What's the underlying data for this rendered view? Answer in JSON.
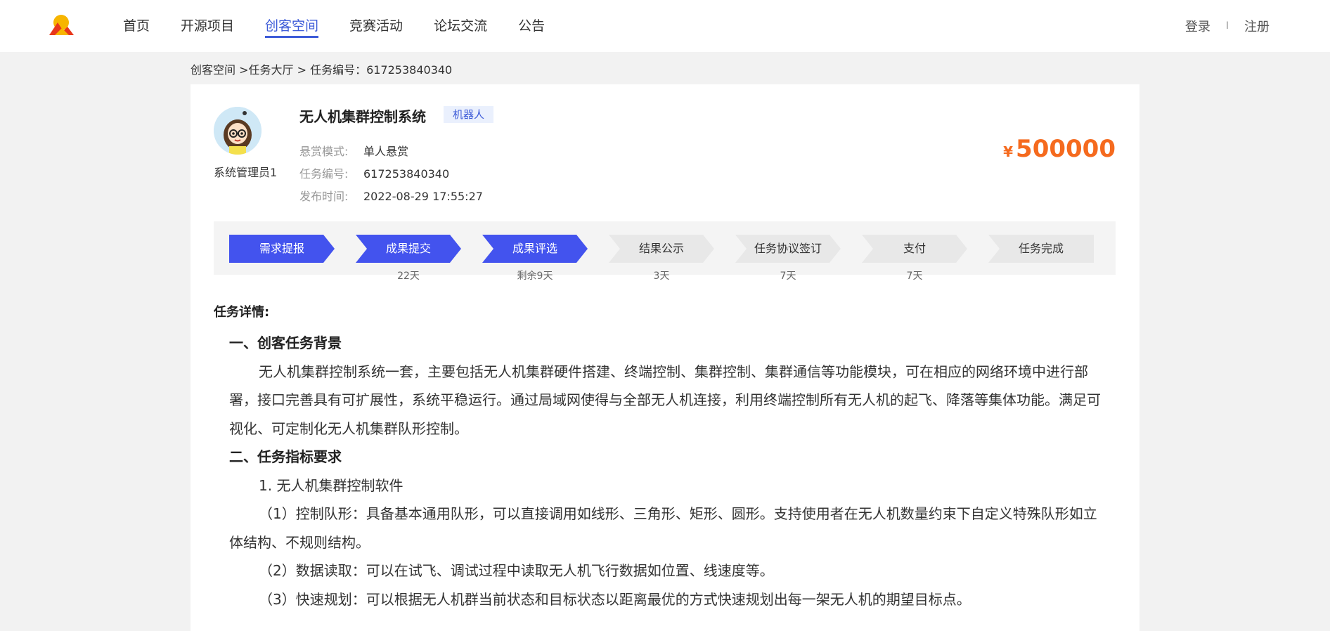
{
  "nav": {
    "items": [
      "首页",
      "开源项目",
      "创客空间",
      "竞赛活动",
      "论坛交流",
      "公告"
    ],
    "active_index": 2
  },
  "auth": {
    "login": "登录",
    "separator": "I",
    "register": "注册"
  },
  "breadcrumb": "创客空间 >任务大厅 > 任务编号：617253840340",
  "task": {
    "author": "系统管理员1",
    "title": "无人机集群控制系统",
    "tag": "机器人",
    "meta": [
      {
        "label": "悬赏模式:",
        "value": "单人悬赏"
      },
      {
        "label": "任务编号:",
        "value": "617253840340"
      },
      {
        "label": "发布时间:",
        "value": "2022-08-29 17:55:27"
      }
    ],
    "price_currency": "¥",
    "price": "500000"
  },
  "steps": [
    {
      "label": "需求提报",
      "sub": "",
      "active": true
    },
    {
      "label": "成果提交",
      "sub": "22天",
      "active": true
    },
    {
      "label": "成果评选",
      "sub": "剩余9天",
      "active": true
    },
    {
      "label": "结果公示",
      "sub": "3天",
      "active": false
    },
    {
      "label": "任务协议签订",
      "sub": "7天",
      "active": false
    },
    {
      "label": "支付",
      "sub": "7天",
      "active": false
    },
    {
      "label": "任务完成",
      "sub": "",
      "active": false
    }
  ],
  "colors": {
    "accent": "#3d5bd8",
    "step_active": "#4353ee",
    "step_inactive": "#e8e8e8",
    "price": "#f56a1e"
  },
  "detail": {
    "heading": "任务详情:",
    "lines": [
      {
        "cls": "h",
        "text": "一、创客任务背景"
      },
      {
        "cls": "ind",
        "text": "无人机集群控制系统一套，主要包括无人机集群硬件搭建、终端控制、集群控制、集群通信等功能模块，可在相应的网络环境中进行部署，接口完善具有可扩展性，系统平稳运行。通过局域网使得与全部无人机连接，利用终端控制所有无人机的起飞、降落等集体功能。满足可视化、可定制化无人机集群队形控制。"
      },
      {
        "cls": "h",
        "text": "二、任务指标要求"
      },
      {
        "cls": "ind2",
        "text": "1. 无人机集群控制软件"
      },
      {
        "cls": "ind",
        "text": "（1）控制队形：具备基本通用队形，可以直接调用如线形、三角形、矩形、圆形。支持使用者在无人机数量约束下自定义特殊队形如立体结构、不规则结构。"
      },
      {
        "cls": "ind",
        "text": "（2）数据读取：可以在试飞、调试过程中读取无人机飞行数据如位置、线速度等。"
      },
      {
        "cls": "ind",
        "text": "（3）快速规划：可以根据无人机群当前状态和目标状态以距离最优的方式快速规划出每一架无人机的期望目标点。"
      }
    ]
  }
}
